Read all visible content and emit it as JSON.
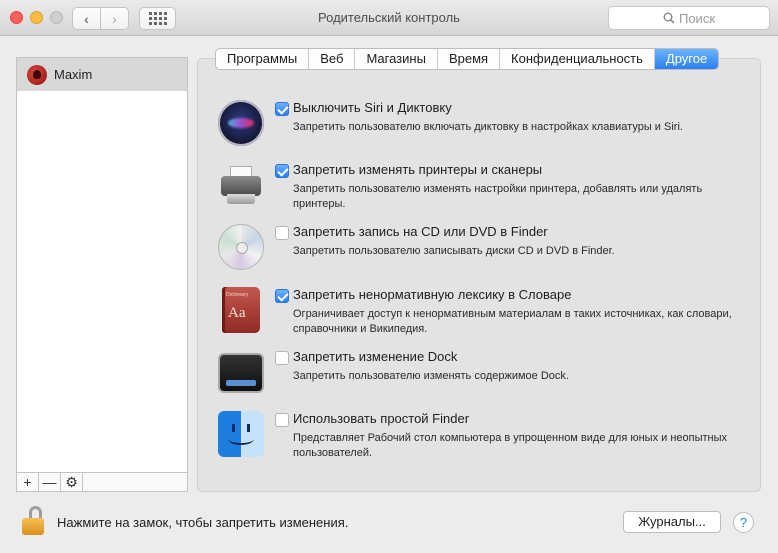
{
  "window": {
    "title": "Родительский контроль",
    "search_placeholder": "Поиск"
  },
  "sidebar": {
    "users": [
      {
        "name": "Maxim"
      }
    ],
    "tools": [
      "+",
      "—",
      "⚙"
    ]
  },
  "tabs": [
    {
      "label": "Программы",
      "active": false
    },
    {
      "label": "Веб",
      "active": false
    },
    {
      "label": "Магазины",
      "active": false
    },
    {
      "label": "Время",
      "active": false
    },
    {
      "label": "Конфиденциальность",
      "active": false
    },
    {
      "label": "Другое",
      "active": true
    }
  ],
  "options": [
    {
      "icon": "siri-icon",
      "checked": true,
      "title": "Выключить Siri и Диктовку",
      "description": "Запретить пользователю включать диктовку в настройках клавиатуры и Siri."
    },
    {
      "icon": "printer-icon",
      "checked": true,
      "title": "Запретить изменять принтеры и сканеры",
      "description": "Запретить пользователю изменять настройки принтера, добавлять или удалять принтеры."
    },
    {
      "icon": "disc-icon",
      "checked": false,
      "title": "Запретить запись на CD или DVD в Finder",
      "description": "Запретить пользователю записывать диски CD и DVD в Finder."
    },
    {
      "icon": "dictionary-icon",
      "checked": true,
      "title": "Запретить ненормативную лексику в Словаре",
      "description": "Ограничивает доступ к ненормативным материалам в таких источниках, как словари, справочники и Википедия."
    },
    {
      "icon": "dock-icon",
      "checked": false,
      "title": "Запретить изменение Dock",
      "description": "Запретить пользователю изменять содержимое Dock."
    },
    {
      "icon": "finder-icon",
      "checked": false,
      "title": "Использовать простой Finder",
      "description": "Представляет Рабочий стол компьютера в упрощенном виде для юных и неопытных пользователей."
    }
  ],
  "footer": {
    "lock_text": "Нажмите на замок, чтобы запретить изменения.",
    "logs_button": "Журналы...",
    "help_button": "?"
  },
  "dictionary_icon": {
    "label": "Aa",
    "header": "Dictionary"
  },
  "colors": {
    "accent": "#2a7ff3",
    "close": "#fc605c",
    "minimize": "#fdbc40",
    "zoom": "#cfcfcf"
  }
}
